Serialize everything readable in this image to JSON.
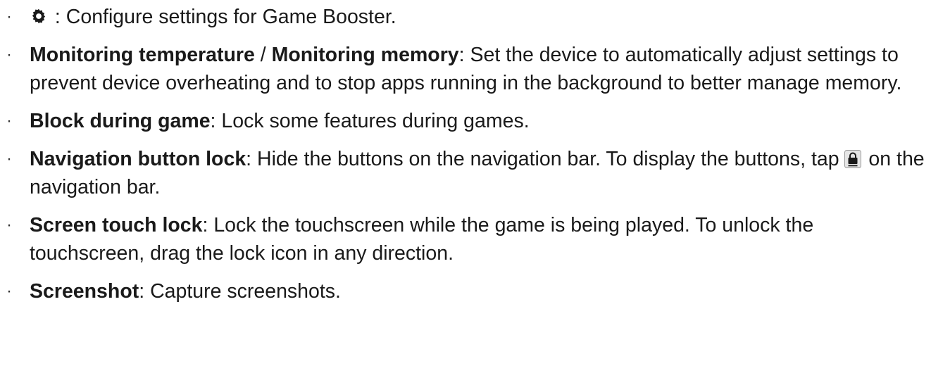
{
  "items": [
    {
      "icon": "gear-icon",
      "term": "",
      "text": ": Configure settings for Game Booster."
    },
    {
      "term": "Monitoring temperature",
      "sep": " / ",
      "term2": "Monitoring memory",
      "text": ": Set the device to automatically adjust settings to prevent device overheating and to stop apps running in the background to better manage memory."
    },
    {
      "term": "Block during game",
      "text": ": Lock some features during games."
    },
    {
      "term": "Navigation button lock",
      "text_before": ": Hide the buttons on the navigation bar. To display the buttons, tap ",
      "icon": "lock-icon",
      "text_after": " on the navigation bar."
    },
    {
      "term": "Screen touch lock",
      "text": ": Lock the touchscreen while the game is being played. To unlock the touchscreen, drag the lock icon in any direction."
    },
    {
      "term": "Screenshot",
      "text": ": Capture screenshots."
    }
  ],
  "bullet_glyph": "·"
}
